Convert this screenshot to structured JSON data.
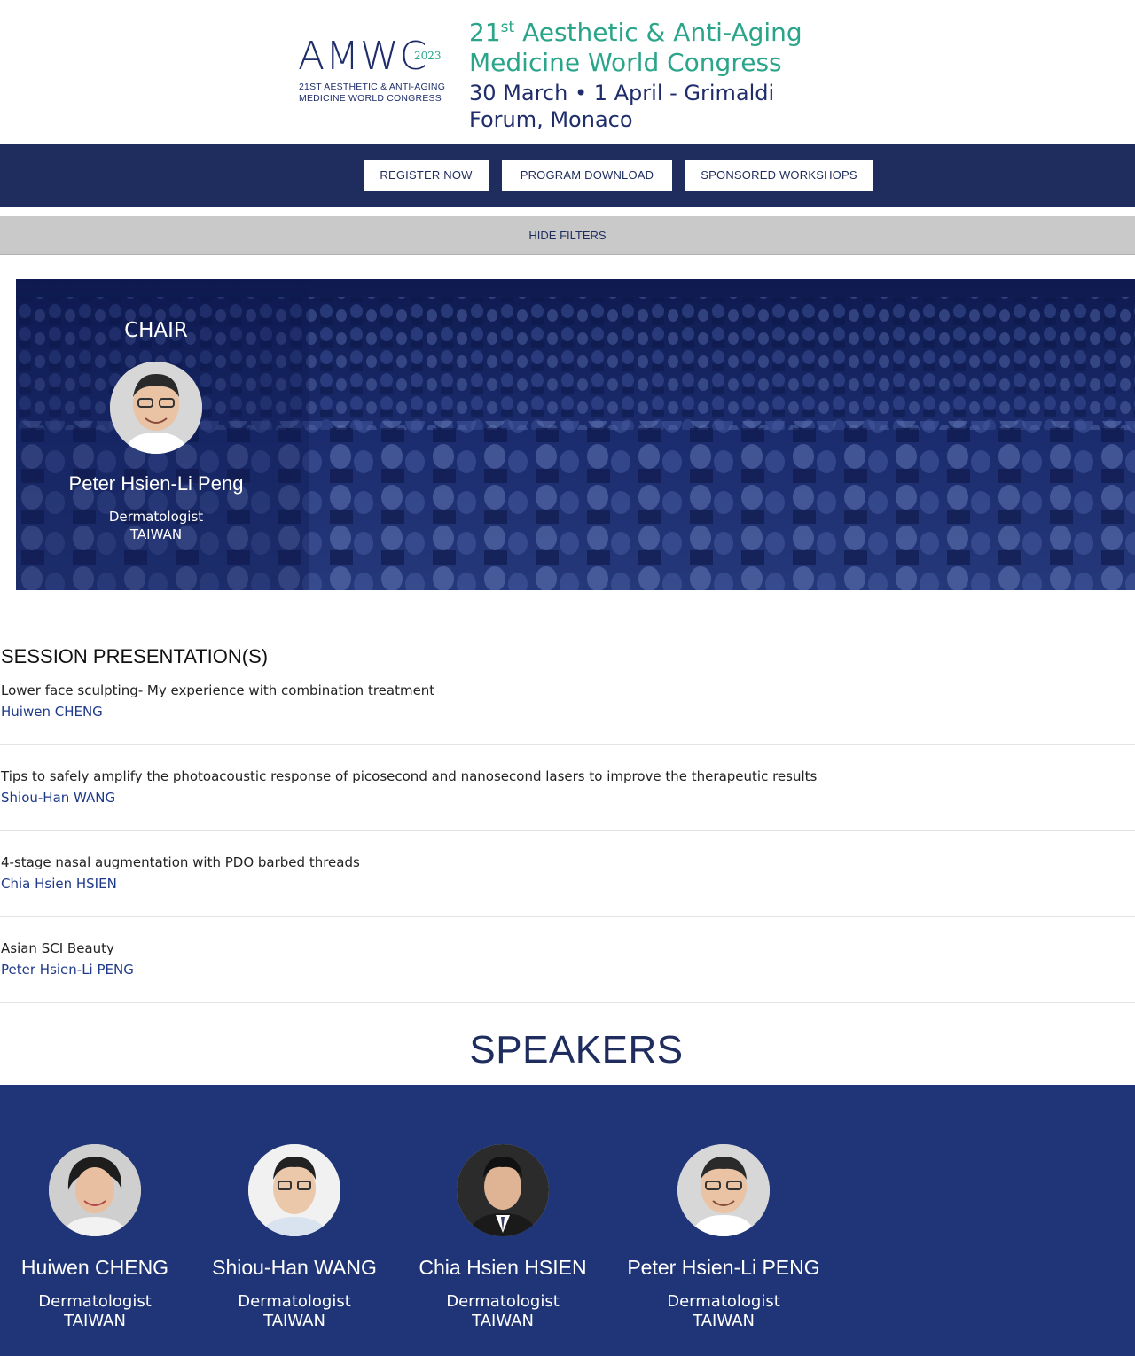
{
  "header": {
    "logo": {
      "mark": "AMWC",
      "year": "2023",
      "subtitle_line1": "21ST AESTHETIC & ANTI-AGING",
      "subtitle_line2": "MEDICINE WORLD CONGRESS"
    },
    "congress": {
      "number": "21",
      "ordinal": "st",
      "title_rest": " Aesthetic & Anti-Aging",
      "title_line2": "Medicine World Congress",
      "date_line1": "30 March • 1 April - Grimaldi",
      "date_line2": "Forum, Monaco"
    }
  },
  "nav": {
    "register": "REGISTER NOW",
    "program": "PROGRAM DOWNLOAD",
    "workshops": "SPONSORED WORKSHOPS"
  },
  "filters": {
    "toggle_label": "HIDE FILTERS"
  },
  "chair": {
    "label": "CHAIR",
    "name": "Peter Hsien-Li Peng",
    "role": "Dermatologist",
    "country": "TAIWAN"
  },
  "session": {
    "title": "SESSION PRESENTATION(S)",
    "presentations": [
      {
        "title": "Lower face sculpting- My experience with combination treatment",
        "author": "Huiwen CHENG"
      },
      {
        "title": "Tips to safely amplify the photoacoustic response of picosecond and nanosecond lasers to improve the therapeutic results",
        "author": "Shiou-Han WANG"
      },
      {
        "title": "4-stage nasal augmentation with PDO barbed threads",
        "author": "Chia Hsien HSIEN"
      },
      {
        "title": "Asian SCI Beauty",
        "author": "Peter Hsien-Li PENG"
      }
    ]
  },
  "speakers": {
    "title": "SPEAKERS",
    "items": [
      {
        "name": "Huiwen CHENG",
        "role": "Dermatologist",
        "country": "TAIWAN"
      },
      {
        "name": "Shiou-Han WANG",
        "role": "Dermatologist",
        "country": "TAIWAN"
      },
      {
        "name": "Chia Hsien HSIEN",
        "role": "Dermatologist",
        "country": "TAIWAN"
      },
      {
        "name": "Peter Hsien-Li PENG",
        "role": "Dermatologist",
        "country": "TAIWAN"
      }
    ]
  },
  "colors": {
    "brand_navy": "#1f2d5e",
    "brand_teal": "#2aa58a",
    "speakers_bg": "#1f3577",
    "link_blue": "#1f3a8a",
    "filter_bar": "#c9c9c9"
  }
}
